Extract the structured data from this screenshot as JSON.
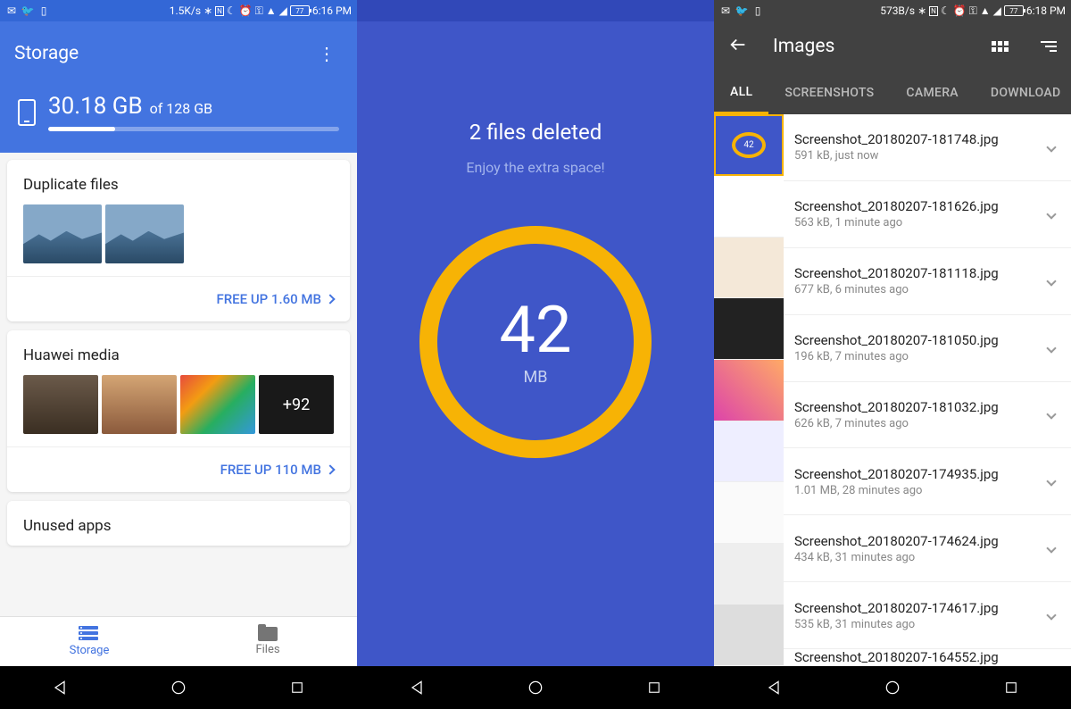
{
  "screen1": {
    "status": {
      "speed": "1.5K/s",
      "time": "6:16 PM",
      "battery": "77"
    },
    "title": "Storage",
    "usage": {
      "used": "30.18 GB",
      "total": "of 128 GB"
    },
    "cards": [
      {
        "title": "Duplicate files",
        "action": "FREE UP 1.60 MB",
        "more": ""
      },
      {
        "title": "Huawei media",
        "action": "FREE UP 110 MB",
        "more": "+92"
      },
      {
        "title": "Unused apps",
        "action": "",
        "more": ""
      }
    ],
    "tabs": [
      {
        "label": "Storage",
        "active": true
      },
      {
        "label": "Files",
        "active": false
      }
    ]
  },
  "screen2": {
    "status": {
      "speed": "",
      "time": "",
      "battery": ""
    },
    "message": "2 files deleted",
    "subtitle": "Enjoy the extra space!",
    "value": "42",
    "unit": "MB"
  },
  "screen3": {
    "status": {
      "speed": "573B/s",
      "time": "6:18 PM",
      "battery": "77"
    },
    "title": "Images",
    "tabs": [
      "ALL",
      "SCREENSHOTS",
      "CAMERA",
      "DOWNLOAD"
    ],
    "files": [
      {
        "name": "Screenshot_20180207-181748.jpg",
        "meta": "591 kB, just now"
      },
      {
        "name": "Screenshot_20180207-181626.jpg",
        "meta": "563 kB, 1 minute ago"
      },
      {
        "name": "Screenshot_20180207-181118.jpg",
        "meta": "677 kB, 6 minutes ago"
      },
      {
        "name": "Screenshot_20180207-181050.jpg",
        "meta": "196 kB, 7 minutes ago"
      },
      {
        "name": "Screenshot_20180207-181032.jpg",
        "meta": "626 kB, 7 minutes ago"
      },
      {
        "name": "Screenshot_20180207-174935.jpg",
        "meta": "1.01 MB, 28 minutes ago"
      },
      {
        "name": "Screenshot_20180207-174624.jpg",
        "meta": "434 kB, 31 minutes ago"
      },
      {
        "name": "Screenshot_20180207-174617.jpg",
        "meta": "535 kB, 31 minutes ago"
      },
      {
        "name": "Screenshot_20180207-164552.jpg",
        "meta": ""
      }
    ],
    "thumb_value": "42"
  }
}
